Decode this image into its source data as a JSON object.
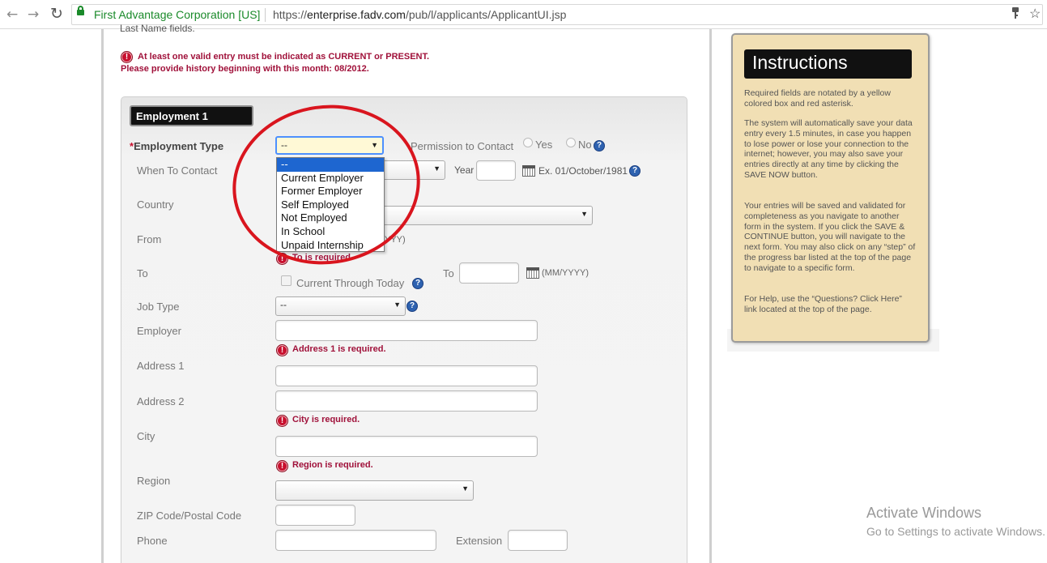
{
  "browser": {
    "back_icon": "←",
    "forward_icon": "→",
    "reload_icon": "↻",
    "site_name": "First Advantage Corporation [US]",
    "url_scheme": "https://",
    "url_host": "enterprise.fadv.com",
    "url_path": "/pub/l/applicants/ApplicantUI.jsp",
    "star_icon": "☆"
  },
  "page": {
    "clipped_top_text": "Last Name fields.",
    "warning_line1": "At least one valid entry must be indicated as CURRENT or PRESENT.",
    "warning_line2": "Please provide history beginning with this month: 08/2012.",
    "error_icon_glyph": "!",
    "help_glyph": "?",
    "section_title": "Employment 1",
    "employment_type": {
      "required_mark": "*",
      "label": "Employment Type",
      "value": "--"
    },
    "dropdown_options": [
      "--",
      "Current Employer",
      "Former Employer",
      "Self Employed",
      "Not Employed",
      "In School",
      "Unpaid Internship"
    ],
    "permission": {
      "label": "Permission to Contact",
      "yes": "Yes",
      "no": "No"
    },
    "when_to_contact": {
      "label": "When To Contact",
      "year_label": "Year",
      "example": "Ex. 01/October/1981"
    },
    "country_label": "Country",
    "from": {
      "label": "From",
      "format_partial": "YYY)"
    },
    "to": {
      "label": "To",
      "error": "To is required.",
      "current_through_today": "Current Through Today",
      "to_label2": "To",
      "format": "(MM/YYYY)"
    },
    "job_type": {
      "label": "Job Type",
      "value": "--"
    },
    "employer_label": "Employer",
    "address1": {
      "label": "Address 1",
      "error": "Address 1 is required."
    },
    "address2_label": "Address 2",
    "city": {
      "label": "City",
      "error": "City is required."
    },
    "region": {
      "label": "Region",
      "error": "Region is required."
    },
    "zip_label": "ZIP Code/Postal Code",
    "phone_label": "Phone",
    "extension_label": "Extension"
  },
  "instructions": {
    "title": "Instructions",
    "p1": "Required fields are notated by a yellow colored box and red asterisk.",
    "p2": "The system will automatically save your data entry every 1.5 minutes, in case you happen to lose power or lose your connection to the internet; however, you may also save your entries directly at any time by clicking the SAVE NOW button.",
    "p3": "Your entries will be saved and validated for completeness as you navigate to another form in the system. If you click the SAVE & CONTINUE button, you will navigate to the next form. You may also click on any “step” of the progress bar listed at the top of the page to navigate to a specific form.",
    "p4": "For Help, use the “Questions? Click Here” link located at the top of the page."
  },
  "watermark": {
    "line1": "Activate Windows",
    "line2": "Go to Settings to activate Windows."
  },
  "colors": {
    "error": "#a0113a",
    "instructions_bg": "#f1dfb4",
    "selected_option": "#1e66d0",
    "annotation_circle": "#d9151e",
    "secure_green": "#1a8a2a"
  }
}
